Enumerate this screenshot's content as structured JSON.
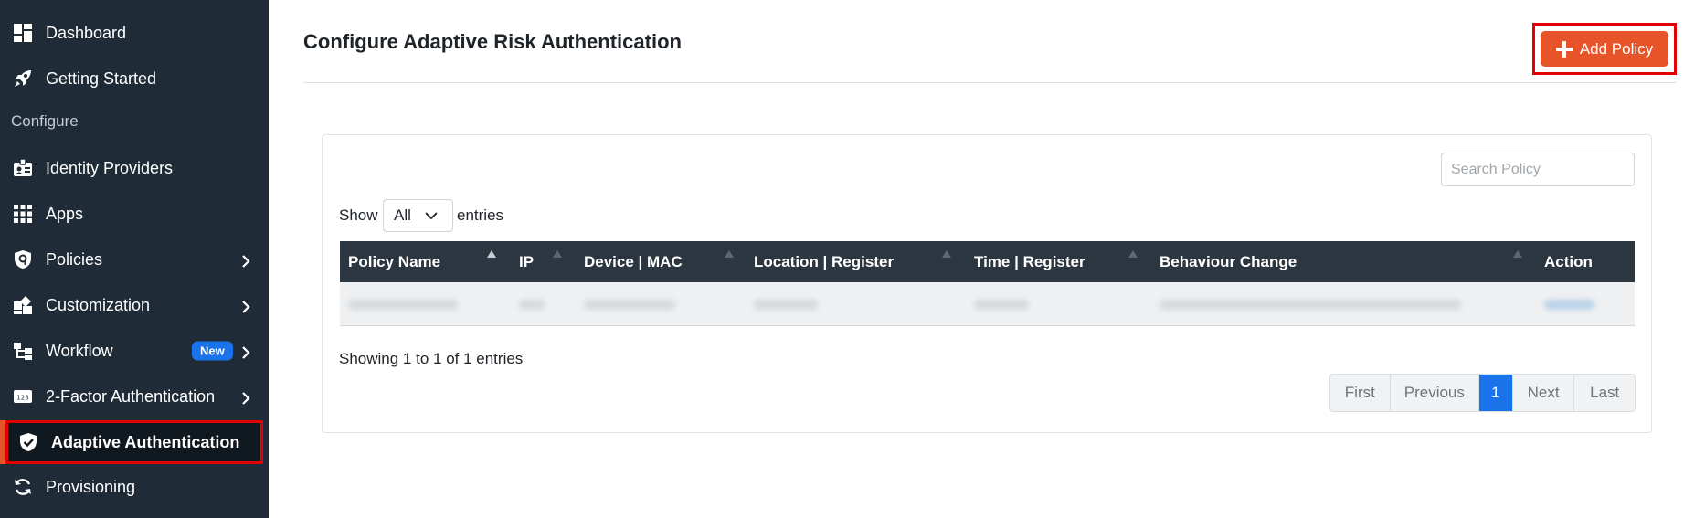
{
  "sidebar": {
    "items": [
      {
        "label": "Dashboard",
        "icon": "dashboard-icon"
      },
      {
        "label": "Getting Started",
        "icon": "rocket-icon"
      },
      {
        "label": "Identity Providers",
        "icon": "id-badge-icon"
      },
      {
        "label": "Apps",
        "icon": "grid-icon"
      },
      {
        "label": "Policies",
        "icon": "shield-lock-icon"
      },
      {
        "label": "Customization",
        "icon": "puzzle-icon"
      },
      {
        "label": "Workflow",
        "icon": "workflow-icon",
        "badge": "New"
      },
      {
        "label": "2-Factor Authentication",
        "icon": "keypad-icon"
      },
      {
        "label": "Adaptive Authentication",
        "icon": "shield-check-icon"
      },
      {
        "label": "Provisioning",
        "icon": "sync-icon"
      }
    ],
    "section_title": "Configure",
    "active_item": "Adaptive Authentication"
  },
  "header": {
    "title": "Configure Adaptive Risk Authentication",
    "add_policy_label": "Add Policy"
  },
  "table_controls": {
    "search_placeholder": "Search Policy",
    "show_label": "Show",
    "show_value": "All",
    "entries_label": "entries"
  },
  "table": {
    "columns": [
      "Policy Name",
      "IP",
      "Device | MAC",
      "Location | Register",
      "Time | Register",
      "Behaviour Change",
      "Action"
    ]
  },
  "footer": {
    "showing_text": "Showing 1 to 1 of 1 entries",
    "pagination": [
      "First",
      "Previous",
      "1",
      "Next",
      "Last"
    ],
    "current_page": "1"
  },
  "colors": {
    "sidebar_bg": "#1f2b36",
    "accent": "#e8542a",
    "highlight": "#e20000",
    "primary": "#1a73e8"
  }
}
